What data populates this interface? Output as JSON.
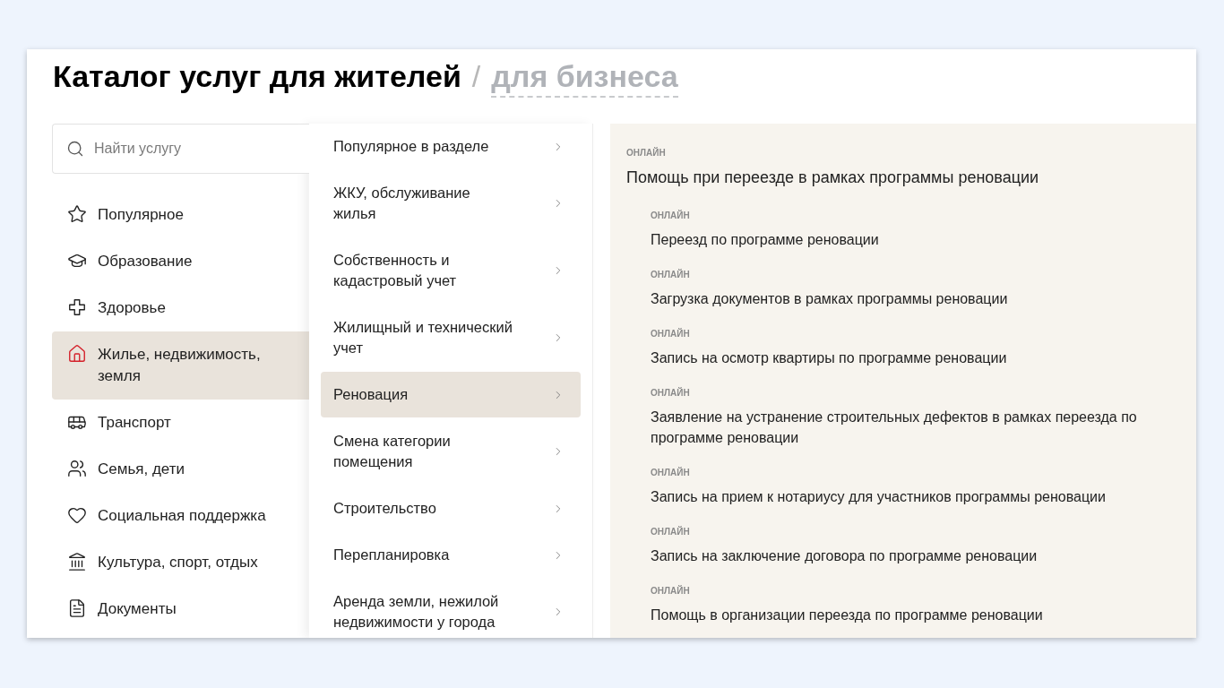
{
  "header": {
    "title": "Каталог услуг для жителей",
    "separator": "/",
    "link": "для бизнеса"
  },
  "search": {
    "placeholder": "Найти услугу"
  },
  "categories": [
    {
      "label": "Популярное",
      "selected": false
    },
    {
      "label": "Образование",
      "selected": false
    },
    {
      "label": "Здоровье",
      "selected": false
    },
    {
      "label": "Жилье, недвижимость, земля",
      "selected": true
    },
    {
      "label": "Транспорт",
      "selected": false
    },
    {
      "label": "Семья, дети",
      "selected": false
    },
    {
      "label": "Социальная поддержка",
      "selected": false
    },
    {
      "label": "Культура, спорт, отдых",
      "selected": false
    },
    {
      "label": "Документы",
      "selected": false
    }
  ],
  "subcategories": [
    {
      "label": "Популярное в разделе",
      "selected": false
    },
    {
      "label": "ЖКУ, обслуживание жилья",
      "selected": false
    },
    {
      "label": "Собственность и кадастровый учет",
      "selected": false
    },
    {
      "label": "Жилищный и технический учет",
      "selected": false
    },
    {
      "label": "Реновация",
      "selected": true
    },
    {
      "label": "Смена категории помещения",
      "selected": false
    },
    {
      "label": "Строительство",
      "selected": false
    },
    {
      "label": "Перепланировка",
      "selected": false
    },
    {
      "label": "Аренда земли, нежилой недвижимости у города",
      "selected": false
    }
  ],
  "services": [
    {
      "tag": "ОНЛАЙН",
      "title": "Помощь при переезде в рамках программы реновации",
      "children": [
        {
          "tag": "ОНЛАЙН",
          "title": "Переезд по программе реновации"
        },
        {
          "tag": "ОНЛАЙН",
          "title": "Загрузка документов в рамках программы реновации"
        },
        {
          "tag": "ОНЛАЙН",
          "title": "Запись на осмотр квартиры по программе реновации"
        },
        {
          "tag": "ОНЛАЙН",
          "title": "Заявление на устранение строительных дефектов в рамках переезда по программе реновации"
        },
        {
          "tag": "ОНЛАЙН",
          "title": "Запись на прием к нотариусу для участников программы реновации"
        },
        {
          "tag": "ОНЛАЙН",
          "title": "Запись на заключение договора по программе реновации"
        },
        {
          "tag": "ОНЛАЙН",
          "title": "Помощь в организации переезда по программе реновации"
        }
      ]
    }
  ]
}
